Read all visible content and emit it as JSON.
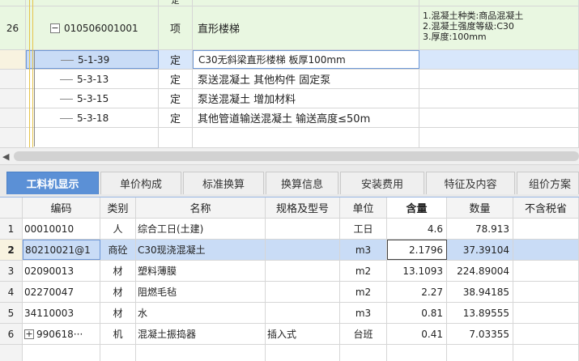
{
  "tree": {
    "rows": [
      {
        "idx": "",
        "code": "",
        "type": "定",
        "name": "",
        "features": ""
      },
      {
        "idx": "26",
        "code": "010506001001",
        "type": "项",
        "name": "直形楼梯",
        "features": [
          "1.混凝土种类:商品混凝土",
          "2.混凝土强度等级:C30",
          "3.厚度:100mm"
        ]
      },
      {
        "idx": "",
        "code": "5-1-39",
        "type": "定",
        "name": "C30无斜梁直形楼梯 板厚100mm",
        "features": ""
      },
      {
        "idx": "",
        "code": "5-3-13",
        "type": "定",
        "name": "泵送混凝土 其他构件 固定泵",
        "features": ""
      },
      {
        "idx": "",
        "code": "5-3-15",
        "type": "定",
        "name": "泵送混凝土 增加材料",
        "features": ""
      },
      {
        "idx": "",
        "code": "5-3-18",
        "type": "定",
        "name": "其他管道输送混凝土 输送高度≤50m",
        "features": ""
      }
    ],
    "collapse_glyph": "−"
  },
  "tabs": [
    "工料机显示",
    "单价构成",
    "标准换算",
    "换算信息",
    "安装费用",
    "特征及内容",
    "组价方案"
  ],
  "table": {
    "headers": [
      "编码",
      "类别",
      "名称",
      "规格及型号",
      "单位",
      "含量",
      "数量",
      "不含税省"
    ],
    "rows": [
      {
        "idx": "1",
        "code": "00010010",
        "cat": "人",
        "name": "综合工日(土建)",
        "spec": "",
        "unit": "工日",
        "qty": "4.6",
        "amt": "78.913",
        "tax": ""
      },
      {
        "idx": "2",
        "code": "80210021@1",
        "cat": "商砼",
        "name": "C30现浇混凝土",
        "spec": "",
        "unit": "m3",
        "qty": "2.1796",
        "amt": "37.39104",
        "tax": ""
      },
      {
        "idx": "3",
        "code": "02090013",
        "cat": "材",
        "name": "塑料薄膜",
        "spec": "",
        "unit": "m2",
        "qty": "13.1093",
        "amt": "224.89004",
        "tax": ""
      },
      {
        "idx": "4",
        "code": "02270047",
        "cat": "材",
        "name": "阻燃毛毡",
        "spec": "",
        "unit": "m2",
        "qty": "2.27",
        "amt": "38.94185",
        "tax": ""
      },
      {
        "idx": "5",
        "code": "34110003",
        "cat": "材",
        "name": "水",
        "spec": "",
        "unit": "m3",
        "qty": "0.81",
        "amt": "13.89555",
        "tax": ""
      },
      {
        "idx": "6",
        "code": "990618···",
        "cat": "机",
        "name": "混凝土振捣器",
        "spec": "插入式",
        "unit": "台班",
        "qty": "0.41",
        "amt": "7.03355",
        "tax": ""
      }
    ],
    "expand_glyph": "+"
  },
  "scroll_left_glyph": "◀"
}
